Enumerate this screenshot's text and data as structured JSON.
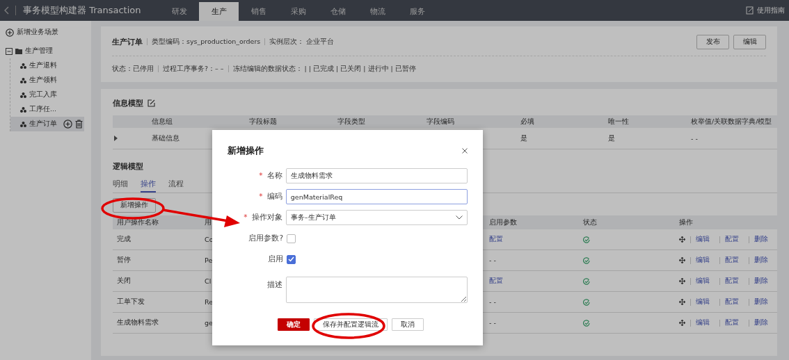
{
  "header": {
    "title": "事务模型构建器 Transaction",
    "nav": [
      {
        "label": "研发",
        "selected": false
      },
      {
        "label": "生产",
        "selected": true
      },
      {
        "label": "销售",
        "selected": false
      },
      {
        "label": "采购",
        "selected": false
      },
      {
        "label": "仓储",
        "selected": false
      },
      {
        "label": "物流",
        "selected": false
      },
      {
        "label": "服务",
        "selected": false
      }
    ],
    "guide": "使用指南"
  },
  "sidebar": {
    "add": "新增业务场景",
    "tree": [
      {
        "label": "生产管理",
        "expanded": true,
        "children": [
          {
            "label": "生产退料",
            "selected": false
          },
          {
            "label": "生产领料",
            "selected": false
          },
          {
            "label": "完工入库",
            "selected": false
          },
          {
            "label": "工序任...",
            "selected": false
          },
          {
            "label": "生产订单",
            "selected": true
          }
        ]
      }
    ]
  },
  "summary": {
    "title": "生产订单",
    "fields": [
      "类型编码：sys_production_orders",
      "实例层次：  企业平台"
    ],
    "buttons": [
      "发布",
      "编辑"
    ],
    "status": [
      "状态：已停用",
      "过程工序事务?：– –",
      "冻结编辑的数据状态：  | | 已完成 | 已关闭 | 进行中 | 已暂停"
    ]
  },
  "info_model": {
    "title": "信息模型",
    "columns": [
      "信息组",
      "字段标题",
      "字段类型",
      "字段编码",
      "必填",
      "唯一性",
      "枚举值/关联数据字典/模型"
    ],
    "rows": [
      {
        "expanded": false,
        "cells": [
          "基础信息",
          "",
          "",
          "",
          "是",
          "是",
          "- -"
        ]
      }
    ]
  },
  "logic_model": {
    "title": "逻辑模型",
    "tabs": [
      {
        "label": "明细",
        "selected": false
      },
      {
        "label": "操作",
        "selected": true
      },
      {
        "label": "流程",
        "selected": false
      }
    ],
    "add_button": "新增操作",
    "columns": [
      "用户操作名称",
      "用",
      "启用参数",
      "状态",
      "操作"
    ],
    "rows": [
      {
        "name": "完成",
        "code": "Co",
        "params": "配置",
        "params_link": true,
        "enabled": true,
        "actions": [
          "编辑",
          "配置",
          "删除"
        ]
      },
      {
        "name": "暂停",
        "code": "Pe",
        "params": "- -",
        "params_link": false,
        "enabled": true,
        "actions": [
          "编辑",
          "配置",
          "删除"
        ]
      },
      {
        "name": "关闭",
        "code": "Cl",
        "params": "配置",
        "params_link": true,
        "enabled": true,
        "actions": [
          "编辑",
          "配置",
          "删除"
        ]
      },
      {
        "name": "工单下发",
        "code": "Re",
        "params": "- -",
        "params_link": false,
        "enabled": true,
        "actions": [
          "编辑",
          "配置",
          "删除"
        ]
      },
      {
        "name": "生成物料需求",
        "code": "ge",
        "params": "- -",
        "params_link": false,
        "enabled": true,
        "actions": [
          "编辑",
          "配置",
          "删除"
        ]
      }
    ]
  },
  "dialog": {
    "title": "新增操作",
    "required_mark": "*",
    "fields": [
      {
        "kind": "text",
        "label": "名称",
        "required": true,
        "value": "生成物料需求",
        "focused": false
      },
      {
        "kind": "text",
        "label": "编码",
        "required": true,
        "value": "genMaterialReq",
        "focused": true
      },
      {
        "kind": "select",
        "label": "操作对象",
        "required": true,
        "value": "事务–生产订单"
      },
      {
        "kind": "checkbox",
        "label": "启用参数?",
        "checked": false
      },
      {
        "kind": "checkbox",
        "label": "启用",
        "checked": true
      },
      {
        "kind": "textarea",
        "label": "描述"
      }
    ],
    "buttons": [
      {
        "label": "确定",
        "primary": true
      },
      {
        "label": "保存并配置逻辑流",
        "primary": false
      },
      {
        "label": "取消",
        "primary": false
      }
    ]
  }
}
